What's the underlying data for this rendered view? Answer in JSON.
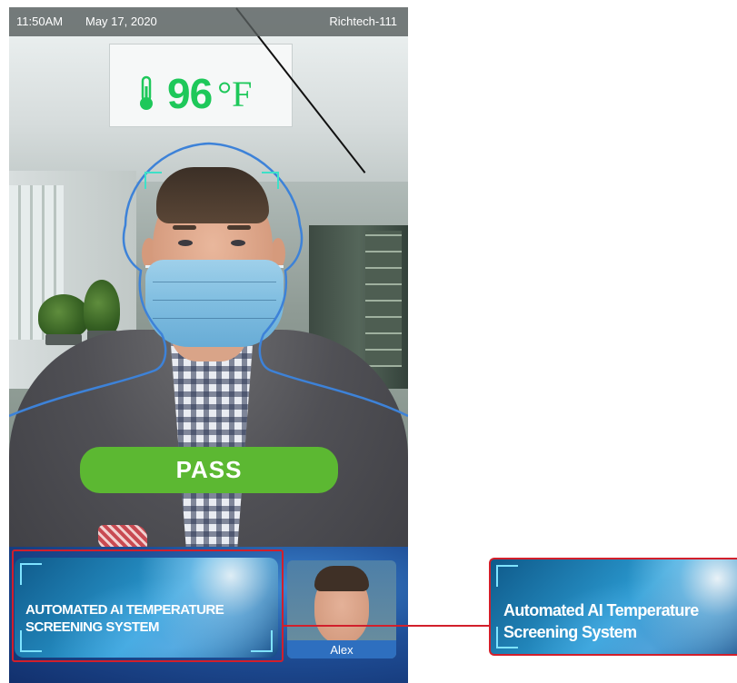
{
  "status_bar": {
    "time": "11:50AM",
    "date": "May 17, 2020",
    "device_name": "Richtech-111"
  },
  "temperature": {
    "icon": "thermometer-icon",
    "value": "96",
    "unit": "°F",
    "color": "#1ec85a"
  },
  "result": {
    "label": "PASS",
    "color": "#5cb832"
  },
  "banner": {
    "title_line1": "AUTOMATED AI TEMPERATURE",
    "title_line2": "SCREENING SYSTEM"
  },
  "recognized_person": {
    "name": "Alex"
  },
  "callout": {
    "title_line1": "Automated AI Temperature",
    "title_line2": "Screening System",
    "highlight_color": "#d21f2b"
  }
}
